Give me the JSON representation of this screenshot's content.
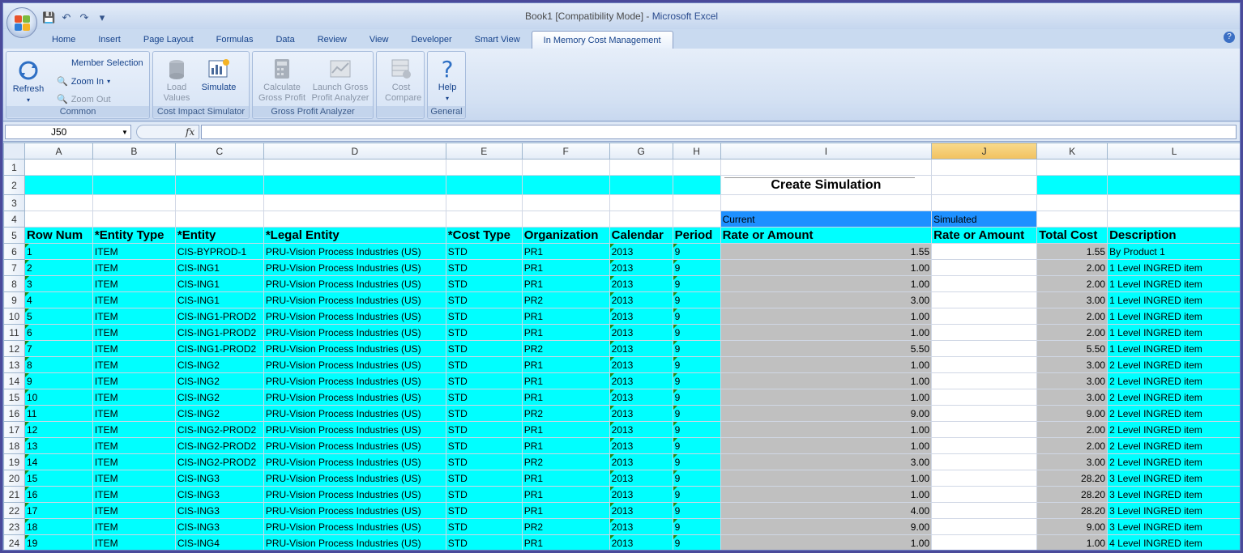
{
  "window": {
    "title": "Book1  [Compatibility Mode] - ",
    "app": "Microsoft Excel"
  },
  "ribbon_tabs": [
    "Home",
    "Insert",
    "Page Layout",
    "Formulas",
    "Data",
    "Review",
    "View",
    "Developer",
    "Smart View",
    "In Memory Cost Management"
  ],
  "active_tab_index": 9,
  "ribbon": {
    "refresh": "Refresh",
    "member_selection": "Member Selection",
    "zoom_in": "Zoom In",
    "zoom_out": "Zoom Out",
    "common_label": "Common",
    "load_values": "Load Values",
    "simulate": "Simulate",
    "cost_impact_label": "Cost Impact Simulator",
    "calculate_gross_profit": "Calculate Gross Profit",
    "launch_gross_profit_analyzer": "Launch Gross Profit Analyzer",
    "gross_profit_label": "Gross Profit Analyzer",
    "cost_compare": "Cost Compare",
    "help": "Help",
    "general_label": "General"
  },
  "name_box": "J50",
  "fx": "fx",
  "columns": [
    "A",
    "B",
    "C",
    "D",
    "E",
    "F",
    "G",
    "H",
    "I",
    "J",
    "K",
    "L"
  ],
  "selected_column": "J",
  "sheet": {
    "create_simulation": "Create Simulation",
    "current": "Current",
    "simulated": "Simulated",
    "headers": [
      "Row Num",
      "*Entity Type",
      "*Entity",
      "*Legal Entity",
      "*Cost Type",
      "Organization",
      "Calendar",
      "Period",
      "Rate or Amount",
      "Rate or Amount",
      "Total Cost",
      "Description"
    ],
    "rows": [
      [
        "1",
        "ITEM",
        "CIS-BYPROD-1",
        "PRU-Vision Process Industries (US)",
        "STD",
        "PR1",
        "2013",
        "9",
        "1.55",
        "",
        "1.55",
        "By Product 1"
      ],
      [
        "2",
        "ITEM",
        "CIS-ING1",
        "PRU-Vision Process Industries (US)",
        "STD",
        "PR1",
        "2013",
        "9",
        "1.00",
        "",
        "2.00",
        "1 Level INGRED item"
      ],
      [
        "3",
        "ITEM",
        "CIS-ING1",
        "PRU-Vision Process Industries (US)",
        "STD",
        "PR1",
        "2013",
        "9",
        "1.00",
        "",
        "2.00",
        "1 Level INGRED item"
      ],
      [
        "4",
        "ITEM",
        "CIS-ING1",
        "PRU-Vision Process Industries (US)",
        "STD",
        "PR2",
        "2013",
        "9",
        "3.00",
        "",
        "3.00",
        "1 Level INGRED item"
      ],
      [
        "5",
        "ITEM",
        "CIS-ING1-PROD2",
        "PRU-Vision Process Industries (US)",
        "STD",
        "PR1",
        "2013",
        "9",
        "1.00",
        "",
        "2.00",
        "1 Level INGRED item"
      ],
      [
        "6",
        "ITEM",
        "CIS-ING1-PROD2",
        "PRU-Vision Process Industries (US)",
        "STD",
        "PR1",
        "2013",
        "9",
        "1.00",
        "",
        "2.00",
        "1 Level INGRED item"
      ],
      [
        "7",
        "ITEM",
        "CIS-ING1-PROD2",
        "PRU-Vision Process Industries (US)",
        "STD",
        "PR2",
        "2013",
        "9",
        "5.50",
        "",
        "5.50",
        "1 Level INGRED item"
      ],
      [
        "8",
        "ITEM",
        "CIS-ING2",
        "PRU-Vision Process Industries (US)",
        "STD",
        "PR1",
        "2013",
        "9",
        "1.00",
        "",
        "3.00",
        "2 Level INGRED item"
      ],
      [
        "9",
        "ITEM",
        "CIS-ING2",
        "PRU-Vision Process Industries (US)",
        "STD",
        "PR1",
        "2013",
        "9",
        "1.00",
        "",
        "3.00",
        "2 Level INGRED item"
      ],
      [
        "10",
        "ITEM",
        "CIS-ING2",
        "PRU-Vision Process Industries (US)",
        "STD",
        "PR1",
        "2013",
        "9",
        "1.00",
        "",
        "3.00",
        "2 Level INGRED item"
      ],
      [
        "11",
        "ITEM",
        "CIS-ING2",
        "PRU-Vision Process Industries (US)",
        "STD",
        "PR2",
        "2013",
        "9",
        "9.00",
        "",
        "9.00",
        "2 Level INGRED item"
      ],
      [
        "12",
        "ITEM",
        "CIS-ING2-PROD2",
        "PRU-Vision Process Industries (US)",
        "STD",
        "PR1",
        "2013",
        "9",
        "1.00",
        "",
        "2.00",
        "2 Level INGRED item"
      ],
      [
        "13",
        "ITEM",
        "CIS-ING2-PROD2",
        "PRU-Vision Process Industries (US)",
        "STD",
        "PR1",
        "2013",
        "9",
        "1.00",
        "",
        "2.00",
        "2 Level INGRED item"
      ],
      [
        "14",
        "ITEM",
        "CIS-ING2-PROD2",
        "PRU-Vision Process Industries (US)",
        "STD",
        "PR2",
        "2013",
        "9",
        "3.00",
        "",
        "3.00",
        "2 Level INGRED item"
      ],
      [
        "15",
        "ITEM",
        "CIS-ING3",
        "PRU-Vision Process Industries (US)",
        "STD",
        "PR1",
        "2013",
        "9",
        "1.00",
        "",
        "28.20",
        "3 Level INGRED item"
      ],
      [
        "16",
        "ITEM",
        "CIS-ING3",
        "PRU-Vision Process Industries (US)",
        "STD",
        "PR1",
        "2013",
        "9",
        "1.00",
        "",
        "28.20",
        "3 Level INGRED item"
      ],
      [
        "17",
        "ITEM",
        "CIS-ING3",
        "PRU-Vision Process Industries (US)",
        "STD",
        "PR1",
        "2013",
        "9",
        "4.00",
        "",
        "28.20",
        "3 Level INGRED item"
      ],
      [
        "18",
        "ITEM",
        "CIS-ING3",
        "PRU-Vision Process Industries (US)",
        "STD",
        "PR2",
        "2013",
        "9",
        "9.00",
        "",
        "9.00",
        "3 Level INGRED item"
      ],
      [
        "19",
        "ITEM",
        "CIS-ING4",
        "PRU-Vision Process Industries (US)",
        "STD",
        "PR1",
        "2013",
        "9",
        "1.00",
        "",
        "1.00",
        "4 Level INGRED item"
      ]
    ]
  },
  "colors": {
    "cyan": "#00ffff",
    "gray": "#c0c0c0",
    "blue": "#1e90ff",
    "selected_header": "#f1c15f"
  }
}
